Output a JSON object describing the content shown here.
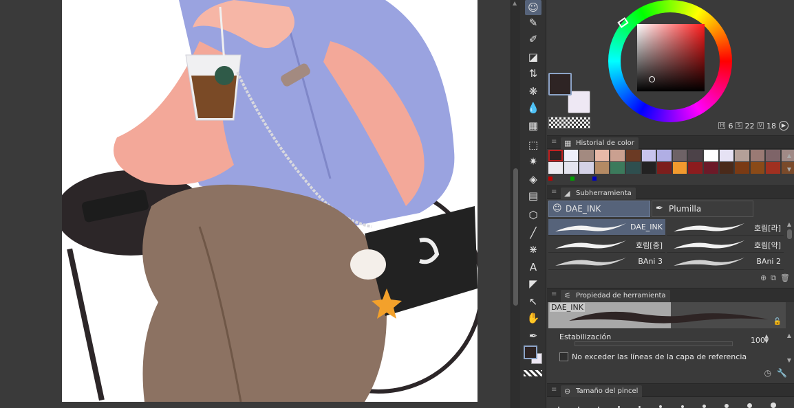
{
  "canvas": {
    "description_hidden": true
  },
  "toolbar": {
    "tools": [
      {
        "name": "brush-doll-tool",
        "glyph": "☺",
        "active": true
      },
      {
        "name": "pen-tool",
        "glyph": "✎",
        "active": false
      },
      {
        "name": "marker-tool",
        "glyph": "✐",
        "active": false
      },
      {
        "name": "eraser-tool",
        "glyph": "◪",
        "active": false
      },
      {
        "name": "layer-move-tool",
        "glyph": "⇅",
        "active": false
      },
      {
        "name": "decoration-tool",
        "glyph": "❋",
        "active": false
      },
      {
        "name": "blend-tool",
        "glyph": "💧",
        "active": false
      },
      {
        "name": "grid-tool",
        "glyph": "▦",
        "active": false
      },
      {
        "name": "selection-tool",
        "glyph": "⬚",
        "active": false
      },
      {
        "name": "auto-select-tool",
        "glyph": "✷",
        "active": false
      },
      {
        "name": "fill-tool",
        "glyph": "◈",
        "active": false
      },
      {
        "name": "gradient-tool",
        "glyph": "▤",
        "active": false
      },
      {
        "name": "3d-tool",
        "glyph": "⬡",
        "active": false
      },
      {
        "name": "line-tool",
        "glyph": "╱",
        "active": false
      },
      {
        "name": "frame-tool",
        "glyph": "⋇",
        "active": false
      },
      {
        "name": "text-tool",
        "glyph": "A",
        "active": false
      },
      {
        "name": "balloon-tool",
        "glyph": "◤",
        "active": false
      },
      {
        "name": "object-tool",
        "glyph": "↖",
        "active": false
      },
      {
        "name": "hand-tool",
        "glyph": "✋",
        "active": false
      },
      {
        "name": "eyedropper-tool",
        "glyph": "✒",
        "active": false
      }
    ]
  },
  "color_wheel": {
    "main_color": "#2e2424",
    "sub_color": "#eee8f4",
    "h_value": "6",
    "s_value": "22",
    "v_value": "18",
    "h_label": "H",
    "s_label": "S",
    "v_label": "V"
  },
  "color_history": {
    "tab_label": "Historial de color",
    "swatches": [
      "#2e2424",
      "#eef0fa",
      "#a38a80",
      "#e8b9a8",
      "#caa090",
      "#6b3a24",
      "#c8c4ee",
      "#b0aee4",
      "#6e6266",
      "#4c4248",
      "#ffffff",
      "#e6e2f4",
      "#b4a098",
      "#9a7a74",
      "#7e6468",
      "#a08a86",
      "#eceaf0",
      "#e4e4ee",
      "#d4d2e6",
      "#b48a64",
      "#3c7a5c",
      "#2f4f4f",
      "#232222",
      "#7c1e1c",
      "#f29a2e",
      "#8c1c1e",
      "#6c1a28",
      "#4a2a1a",
      "#7a3a14",
      "#8a4a18",
      "#a03020",
      "#7a4a2a"
    ],
    "mini": [
      "#c00000",
      "#00a000",
      "#0000c0"
    ]
  },
  "subtool": {
    "tab_label": "Subherramienta",
    "groups": [
      {
        "label": "DAE_INK",
        "active": true
      },
      {
        "label": "Plumilla",
        "active": false
      }
    ],
    "brushes": [
      {
        "label": "DAE_INK",
        "active": true
      },
      {
        "label": "호림[라]",
        "active": false
      },
      {
        "label": "호림[중]",
        "active": false
      },
      {
        "label": "호림[약]",
        "active": false
      },
      {
        "label": "BAni 3",
        "active": false
      },
      {
        "label": "BAni 2",
        "active": false
      }
    ]
  },
  "tool_property": {
    "tab_label": "Propiedad de herramienta",
    "preview_name": "DAE_INK",
    "stabilization_label": "Estabilización",
    "stabilization_value": "100",
    "stabilization_fraction": 1.0,
    "reference_label": "No exceder las líneas de la capa de referencia"
  },
  "brush_size": {
    "tab_label": "Tamaño del pincel"
  }
}
